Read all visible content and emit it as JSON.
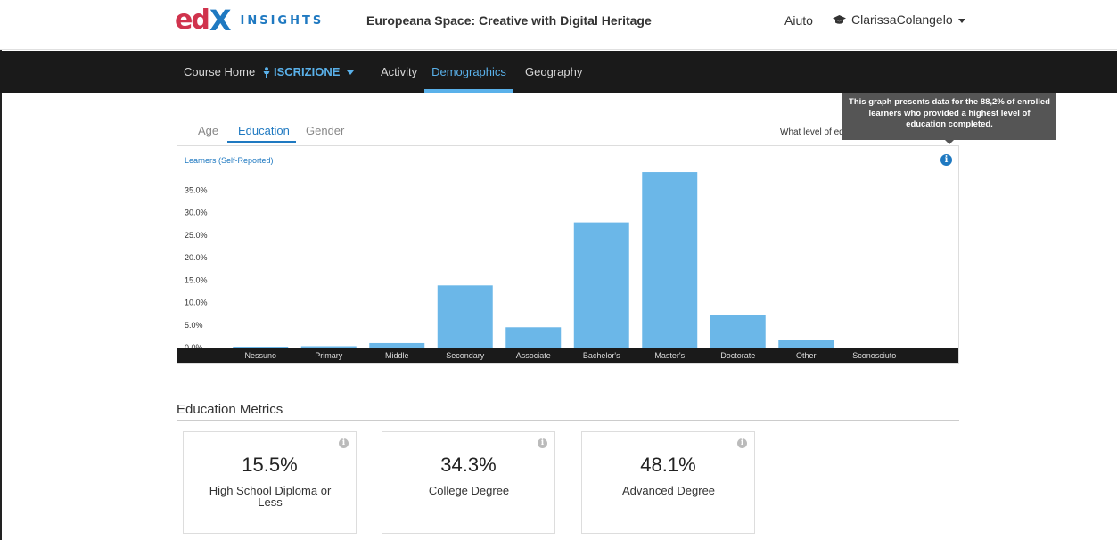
{
  "header": {
    "logo_text": "edX",
    "logo_product": "INSIGHTS",
    "course_title": "Europeana Space: Creative with Digital Heritage",
    "help_label": "Aiuto",
    "username": "ClarissaColangelo"
  },
  "nav": {
    "items": [
      {
        "label": "Course Home",
        "active": false
      },
      {
        "label": "ISCRIZIONE",
        "active": false
      },
      {
        "label": "Activity",
        "active": false
      },
      {
        "label": "Demographics",
        "active": true
      },
      {
        "label": "Geography",
        "active": false
      }
    ]
  },
  "subtabs": [
    {
      "label": "Age",
      "active": false
    },
    {
      "label": "Education",
      "active": true
    },
    {
      "label": "Gender",
      "active": false
    }
  ],
  "question_text": "What level of education do my learners have?",
  "tooltip_text": "This graph presents data for the 88,2% of enrolled learners who provided a highest level of education completed.",
  "chart_data": {
    "type": "bar",
    "ylabel": "Learners (Self-Reported)",
    "categories": [
      "Nessuno",
      "Primary",
      "Middle",
      "Secondary",
      "Associate",
      "Bachelor's",
      "Master's",
      "Doctorate",
      "Other",
      "Sconosciuto"
    ],
    "values": [
      0.2,
      0.3,
      1.0,
      13.8,
      4.5,
      27.8,
      39.0,
      7.2,
      1.7,
      0.0
    ],
    "yticks": [
      "0.0%",
      "5.0%",
      "10.0%",
      "15.0%",
      "20.0%",
      "25.0%",
      "30.0%",
      "35.0%"
    ],
    "ylim": [
      0,
      40
    ],
    "bar_color": "#6bb7e8",
    "axis_band_color": "#1a1a1a"
  },
  "metrics": {
    "title": "Education Metrics",
    "cards": [
      {
        "value": "15.5%",
        "label": "High School Diploma or Less"
      },
      {
        "value": "34.3%",
        "label": "College Degree"
      },
      {
        "value": "48.1%",
        "label": "Advanced Degree"
      }
    ]
  },
  "colors": {
    "accent": "#1f79c1",
    "nav_active": "#5ab1ea",
    "brand_red": "#d0334d",
    "navbar_bg": "#1a1a1a"
  }
}
